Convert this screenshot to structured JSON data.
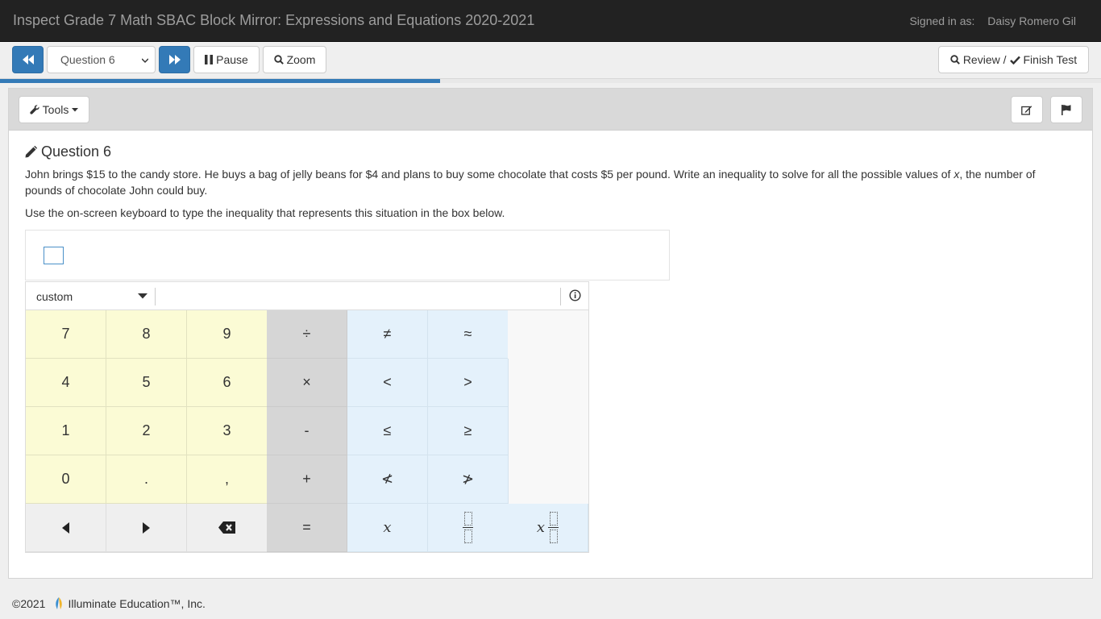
{
  "header": {
    "title": "Inspect Grade 7 Math SBAC Block Mirror: Expressions and Equations 2020-2021",
    "signed_in_label": "Signed in as:",
    "user_name": "Daisy Romero Gil"
  },
  "toolbar": {
    "question_select": "Question 6",
    "pause_label": "Pause",
    "zoom_label": "Zoom",
    "review_label": "Review /",
    "finish_label": "Finish Test",
    "progress_fraction": 0.4
  },
  "panel": {
    "tools_label": "Tools"
  },
  "question": {
    "title": "Question 6",
    "text_before_var": "John brings $15 to the candy store. He buys a bag of jelly beans for $4 and plans to buy some chocolate that costs $5 per pound. Write an inequality to solve for all the possible values of ",
    "variable": "x",
    "text_after_var": ", the number of pounds of chocolate John could buy.",
    "instruction": "Use the on-screen keyboard to type the inequality that represents this situation in the box below."
  },
  "keypad": {
    "mode": "custom",
    "keys": {
      "seven": "7",
      "eight": "8",
      "nine": "9",
      "divide": "÷",
      "not_equal": "≠",
      "approx": "≈",
      "four": "4",
      "five": "5",
      "six": "6",
      "times": "×",
      "less": "<",
      "greater": ">",
      "one": "1",
      "two": "2",
      "three": "3",
      "minus": "-",
      "less_equal": "≤",
      "greater_equal": "≥",
      "zero": "0",
      "decimal": ".",
      "comma": ",",
      "plus": "+",
      "not_less": "≮",
      "not_greater": "≯",
      "equals": "=",
      "variable_x": "x",
      "variable_x_frac": "x"
    }
  },
  "footer": {
    "copyright": "©2021",
    "company": "Illuminate Education™, Inc."
  },
  "colors": {
    "header_bg": "#222222",
    "primary": "#337ab7",
    "keypad_number": "#fbfbd5",
    "keypad_operator": "#d6d6d6",
    "keypad_relation": "#e4f1fb"
  }
}
